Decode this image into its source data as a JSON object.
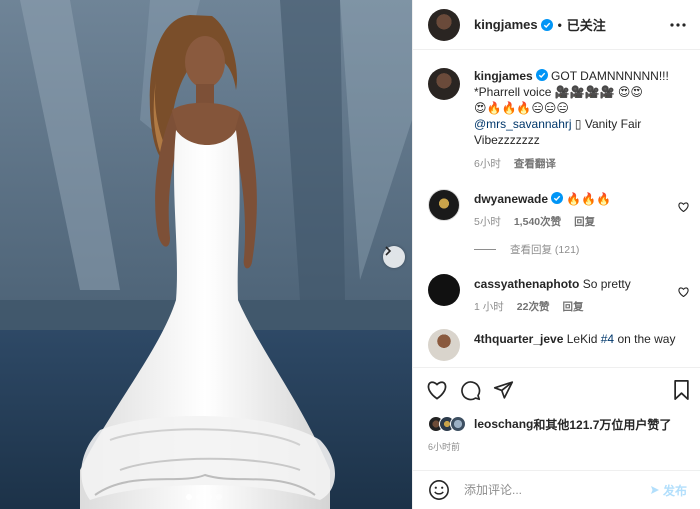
{
  "post": {
    "author": "kingjames",
    "follow_status": "已关注",
    "caption": {
      "lead": "GOT DAMNNNNNN!!! *Pharrell voice",
      "emojis_1": "🎥🎥🎥🎥 😍😍",
      "emojis_2": "😍🔥🔥🔥😑😑😑",
      "mention": "@mrs_savannahrj",
      "tail": " ▯ Vanity Fair Vibezzzzzzz",
      "time": "6小时",
      "translate": "查看翻译"
    }
  },
  "comments": [
    {
      "user": "dwyanewade",
      "verified": true,
      "text": "🔥🔥🔥",
      "time": "5小时",
      "likes": "1,540次赞",
      "reply": "回复",
      "view_replies": "查看回复 (121)"
    },
    {
      "user": "cassyathenaphoto",
      "verified": false,
      "text": "So pretty",
      "time": "1 小时",
      "likes": "22次赞",
      "reply": "回复"
    },
    {
      "user": "4thquarter_jeve",
      "verified": false,
      "text_pre": "LeKid ",
      "hashtag": "#4",
      "text_post": " on the way"
    }
  ],
  "likes_line": {
    "liker": "leoschang",
    "rest": "和其他121.7万位用户赞了"
  },
  "post_time": "6小时前",
  "compose": {
    "placeholder": "添加评论...",
    "post_label": "发布"
  },
  "icons": [
    "more-icon",
    "heart-icon",
    "comment-icon",
    "share-icon",
    "bookmark-icon",
    "emoji-icon",
    "verified-icon",
    "chevron-right-icon"
  ],
  "colors": {
    "verified": "#0095f6",
    "link": "#00376b",
    "muted": "#8e8e8e",
    "post_disabled": "#b2dffc"
  },
  "carousel": {
    "count": 4,
    "active": 1
  }
}
